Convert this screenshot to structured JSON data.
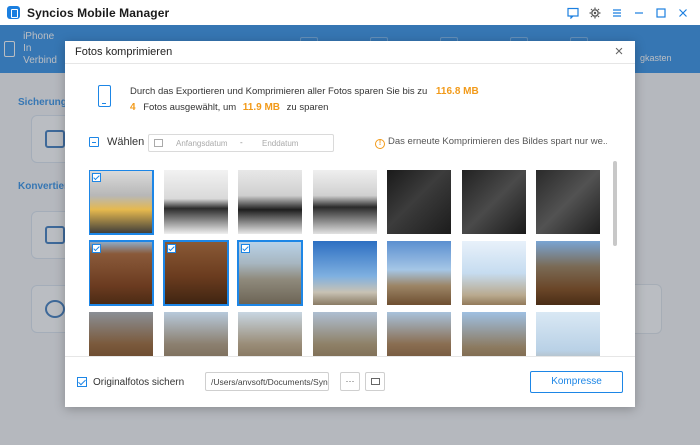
{
  "app": {
    "title": "Syncios Mobile Manager",
    "device_name": "iPhone",
    "device_status": "In Verbind",
    "nav_tail": "gkasten",
    "section_sicherung": "Sicherung",
    "section_konvertier": "Konvertier"
  },
  "dialog": {
    "title": "Fotos komprimieren",
    "info_line1_text": "Durch das Exportieren und Komprimieren aller Fotos sparen Sie bis zu",
    "info_total": "116.8 MB",
    "info_count": "4",
    "info_line2_mid": "Fotos ausgewählt, um",
    "info_selected_size": "11.9 MB",
    "info_line2_end": "zu sparen",
    "select_label": "Wählen",
    "date_start_placeholder": "Anfangsdatum",
    "date_separator": "-",
    "date_end_placeholder": "Enddatum",
    "hint_text": "Das erneute Komprimieren des Bildes spart nur we...",
    "backup_label": "Originalfotos sichern",
    "backup_path": "/Users/anvsoft/Documents/Syncios",
    "browse_label": "···",
    "compress_label": "Kompresse"
  },
  "photos": [
    {
      "selected": true,
      "bg": "linear-gradient(180deg,#dcdcdc 0%,#b7b7b7 40%,#e6b94e 62%,#3a3a3a 100%)"
    },
    {
      "selected": false,
      "bg": "linear-gradient(180deg,#f2f2f2 0%,#d9d9d9 45%,#2b2b2b 60%,#f0f0f0 100%)"
    },
    {
      "selected": false,
      "bg": "linear-gradient(180deg,#e8e8e8 0%,#cfcfcf 40%,#1e1e1e 62%,#e9e9e9 100%)"
    },
    {
      "selected": false,
      "bg": "linear-gradient(180deg,#efefef 0%,#d0d0d0 40%,#2a2a2a 58%,#e2e2e2 100%)"
    },
    {
      "selected": false,
      "bg": "linear-gradient(135deg,#1a1a1a 0%,#3c3c3c 45%,#1c1c1c 100%)"
    },
    {
      "selected": false,
      "bg": "linear-gradient(135deg,#222 0%,#4a4a4a 50%,#1a1a1a 100%)"
    },
    {
      "selected": false,
      "bg": "linear-gradient(135deg,#2a2a2a 0%,#525252 50%,#1e1e1e 100%)"
    },
    {
      "selected": true,
      "bg": "linear-gradient(180deg,#8fb0cf 0%,#8a5a3a 20%,#6b3b20 70%,#4a2a14 100%)"
    },
    {
      "selected": true,
      "bg": "linear-gradient(180deg,#8a5a36 0%,#6b3c1f 55%,#3e2411 100%)"
    },
    {
      "selected": true,
      "bg": "linear-gradient(180deg,#b9d3ea 0%,#a7b6c0 35%,#8f8a7c 60%,#6b6354 100%)"
    },
    {
      "selected": false,
      "bg": "linear-gradient(180deg,#2d6fc2 0%,#7fb0e0 55%,#c8c2b4 80%,#8a7b64 100%)"
    },
    {
      "selected": false,
      "bg": "linear-gradient(180deg,#5b8fd0 0%,#a5c6e6 45%,#9c8566 70%,#6e4f31 100%)"
    },
    {
      "selected": false,
      "bg": "linear-gradient(180deg,#e8f1fa 0%,#c6dcf0 50%,#b9a98e 85%,#927a5a 100%)"
    },
    {
      "selected": false,
      "bg": "linear-gradient(180deg,#7aa5d4 0%,#7a6a55 40%,#6a4628 75%,#4a2d16 100%)"
    },
    {
      "selected": false,
      "bg": "linear-gradient(180deg,#8a8f95 0%,#7b5a3c 50%,#5a3a22 100%)"
    },
    {
      "selected": false,
      "bg": "linear-gradient(180deg,#b7c9db 0%,#8c8070 50%,#6c5a44 100%)"
    },
    {
      "selected": false,
      "bg": "linear-gradient(180deg,#c8d6e2 0%,#9a8d78 50%,#6e5c44 100%)"
    },
    {
      "selected": false,
      "bg": "linear-gradient(180deg,#aebfd2 0%,#8f8168 50%,#6a563e 100%)"
    },
    {
      "selected": false,
      "bg": "linear-gradient(180deg,#a8c2dc 0%,#8a6e52 50%,#5e4128 100%)"
    },
    {
      "selected": false,
      "bg": "linear-gradient(180deg,#9fc0e2 0%,#8c7a60 55%,#6b5236 100%)"
    },
    {
      "selected": false,
      "bg": "linear-gradient(180deg,#d9e8f4 0%,#b9d1e6 60%,#a89a84 100%)"
    }
  ],
  "colors": {
    "accent": "#1d86e6",
    "highlight": "#f29a19"
  }
}
